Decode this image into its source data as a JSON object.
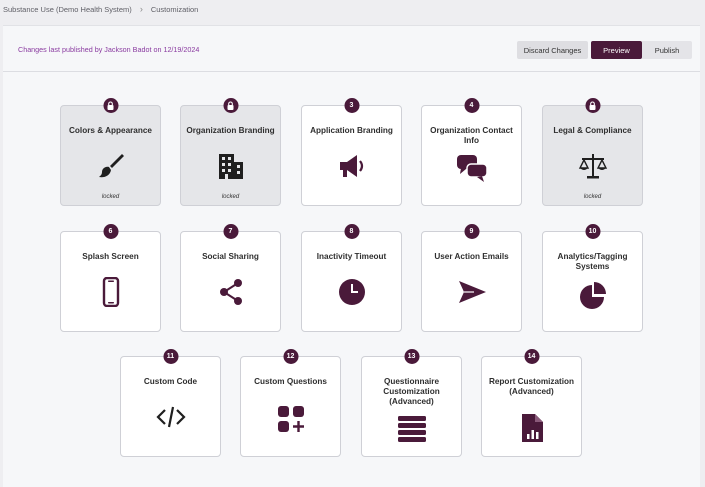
{
  "breadcrumb": {
    "root": "Substance Use (Demo Health System)",
    "current": "Customization"
  },
  "header": {
    "published_text": "Changes last published by Jackson Badot on 12/19/2024",
    "discard_label": "Discard Changes",
    "preview_label": "Preview",
    "publish_label": "Publish"
  },
  "colors": {
    "accent": "#4a1a3a",
    "published_text": "#8a3ba0"
  },
  "cards": [
    {
      "title": "Colors & Appearance",
      "badge": "lock-icon",
      "icon": "paintbrush-icon",
      "status": "locked"
    },
    {
      "title": "Organization Branding",
      "badge": "lock-icon",
      "icon": "building-icon",
      "status": "locked"
    },
    {
      "title": "Application Branding",
      "badge": "3",
      "icon": "megaphone-icon",
      "status": ""
    },
    {
      "title": "Organization Contact Info",
      "badge": "4",
      "icon": "chat-bubbles-icon",
      "status": ""
    },
    {
      "title": "Legal & Compliance",
      "badge": "lock-icon",
      "icon": "scales-icon",
      "status": "locked"
    },
    {
      "title": "Splash Screen",
      "badge": "6",
      "icon": "mobile-phone-icon",
      "status": ""
    },
    {
      "title": "Social Sharing",
      "badge": "7",
      "icon": "share-icon",
      "status": ""
    },
    {
      "title": "Inactivity Timeout",
      "badge": "8",
      "icon": "clock-icon",
      "status": ""
    },
    {
      "title": "User Action Emails",
      "badge": "9",
      "icon": "send-icon",
      "status": ""
    },
    {
      "title": "Analytics/Tagging Systems",
      "badge": "10",
      "icon": "pie-chart-icon",
      "status": ""
    },
    {
      "title": "Custom Code",
      "badge": "11",
      "icon": "code-icon",
      "status": ""
    },
    {
      "title": "Custom Questions",
      "badge": "12",
      "icon": "grid-plus-icon",
      "status": ""
    },
    {
      "title": "Questionnaire Customization (Advanced)",
      "badge": "13",
      "icon": "list-icon",
      "status": ""
    },
    {
      "title": "Report Customization (Advanced)",
      "badge": "14",
      "icon": "report-file-icon",
      "status": ""
    }
  ]
}
